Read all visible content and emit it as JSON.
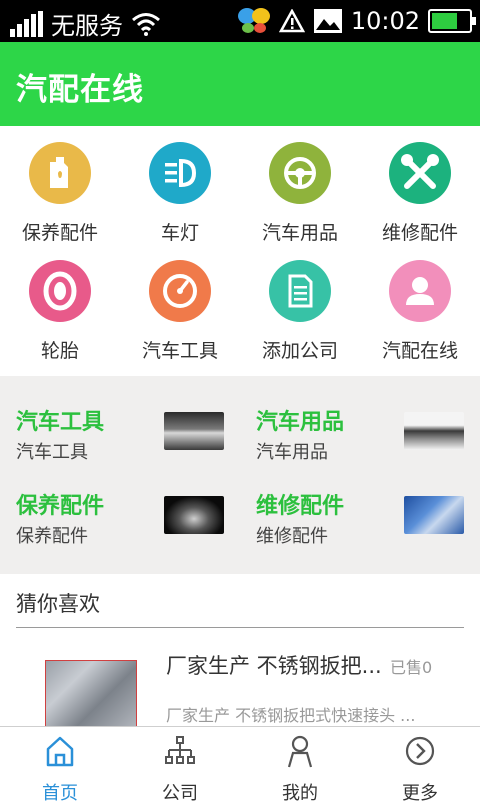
{
  "status_bar": {
    "carrier": "无服务",
    "time": "10:02",
    "battery_level": 0.7
  },
  "app_bar": {
    "title": "汽配在线"
  },
  "categories": [
    {
      "label": "保养配件",
      "icon": "oil-bottle-icon",
      "color": "#e9b949"
    },
    {
      "label": "车灯",
      "icon": "headlight-icon",
      "color": "#1fa9c9"
    },
    {
      "label": "汽车用品",
      "icon": "steering-wheel-icon",
      "color": "#8fb33c"
    },
    {
      "label": "维修配件",
      "icon": "wrench-cross-icon",
      "color": "#1cb27e"
    },
    {
      "label": "轮胎",
      "icon": "tire-icon",
      "color": "#e85a8a"
    },
    {
      "label": "汽车工具",
      "icon": "gauge-icon",
      "color": "#f07a4a"
    },
    {
      "label": "添加公司",
      "icon": "document-icon",
      "color": "#37c2a6"
    },
    {
      "label": "汽配在线",
      "icon": "person-icon",
      "color": "#f28fbb"
    }
  ],
  "promos": [
    {
      "title": "汽车工具",
      "subtitle": "汽车工具"
    },
    {
      "title": "汽车用品",
      "subtitle": "汽车用品"
    },
    {
      "title": "保养配件",
      "subtitle": "保养配件"
    },
    {
      "title": "维修配件",
      "subtitle": "维修配件"
    }
  ],
  "recommend": {
    "section_title": "猜你喜欢",
    "product": {
      "title": "厂家生产 不锈钢扳把...",
      "sold": "已售0",
      "desc": "厂家生产 不锈钢扳把式快速接头 ..."
    }
  },
  "tabs": [
    {
      "label": "首页",
      "icon": "home-icon",
      "active": true
    },
    {
      "label": "公司",
      "icon": "org-chart-icon",
      "active": false
    },
    {
      "label": "我的",
      "icon": "user-icon",
      "active": false
    },
    {
      "label": "更多",
      "icon": "more-icon",
      "active": false
    }
  ],
  "colors": {
    "accent": "#2dd648",
    "promo_title": "#2cc03e",
    "tab_active": "#2a90d8"
  }
}
